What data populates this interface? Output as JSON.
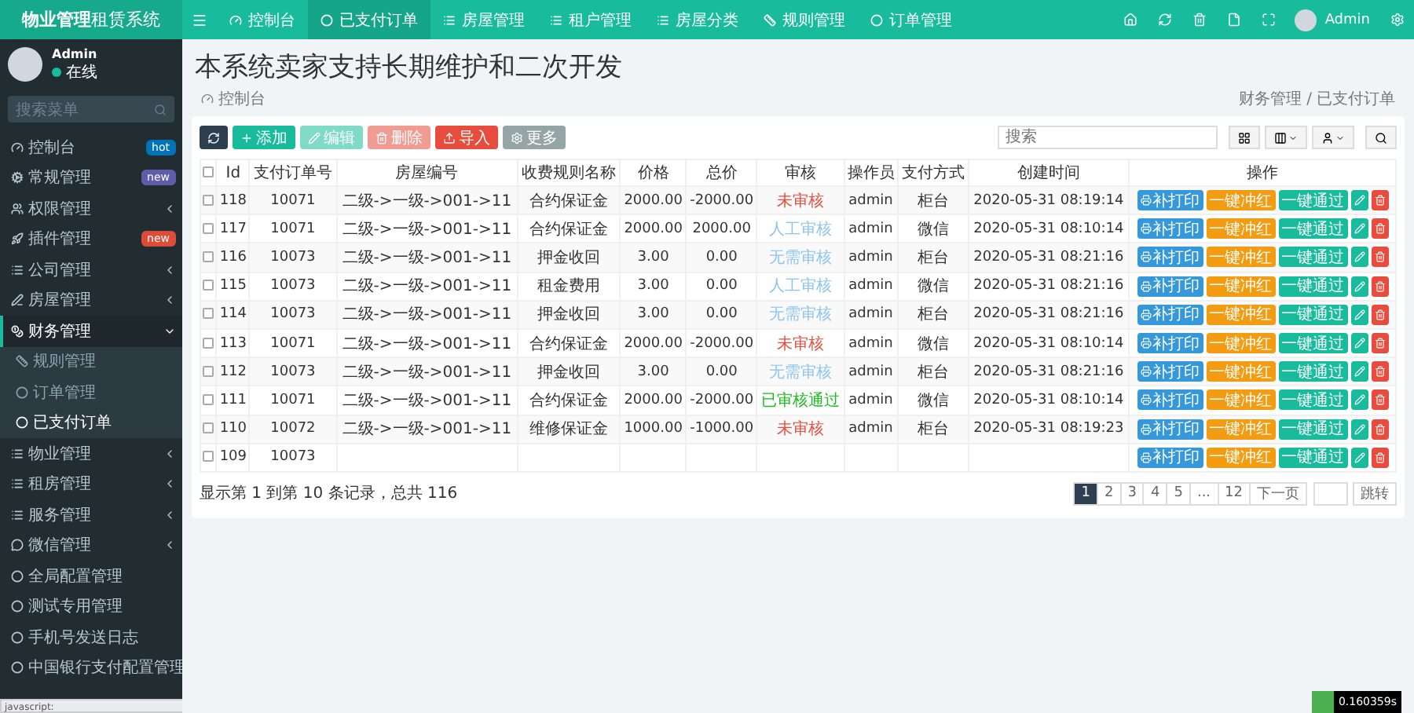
{
  "brand": {
    "bold": "物业管理",
    "rest": "租赁系统"
  },
  "user": {
    "name": "Admin",
    "status": "在线"
  },
  "sidebar": {
    "search_placeholder": "搜索菜单",
    "items": [
      {
        "label": "控制台",
        "badge": {
          "text": "hot",
          "color": "#0073b7"
        }
      },
      {
        "label": "常规管理",
        "badge": {
          "text": "new",
          "color": "#605ca8"
        }
      },
      {
        "label": "权限管理",
        "arrow": true
      },
      {
        "label": "插件管理",
        "badge": {
          "text": "new",
          "color": "#dd4b39"
        }
      },
      {
        "label": "公司管理",
        "arrow": true
      },
      {
        "label": "房屋管理",
        "arrow": true
      },
      {
        "label": "财务管理",
        "arrow": true,
        "expanded": true,
        "children": [
          {
            "label": "规则管理",
            "selected": false
          },
          {
            "label": "订单管理",
            "selected": false
          },
          {
            "label": "已支付订单",
            "selected": true
          }
        ]
      },
      {
        "label": "物业管理",
        "arrow": true
      },
      {
        "label": "租房管理",
        "arrow": true
      },
      {
        "label": "服务管理",
        "arrow": true
      },
      {
        "label": "微信管理",
        "arrow": true
      },
      {
        "label": "全局配置管理"
      },
      {
        "label": "测试专用管理"
      },
      {
        "label": "手机号发送日志"
      },
      {
        "label": "中国银行支付配置管理"
      }
    ]
  },
  "topnav": {
    "tabs": [
      {
        "label": "控制台",
        "selected": false
      },
      {
        "label": "已支付订单",
        "selected": true
      },
      {
        "label": "房屋管理",
        "selected": false
      },
      {
        "label": "租户管理",
        "selected": false
      },
      {
        "label": "房屋分类",
        "selected": false
      },
      {
        "label": "规则管理",
        "selected": false
      },
      {
        "label": "订单管理",
        "selected": false
      }
    ],
    "user": "Admin"
  },
  "page": {
    "title": "本系统卖家支持长期维护和二次开发",
    "home": "控制台",
    "breadcrumb": [
      "财务管理",
      "已支付订单"
    ],
    "separator": "/"
  },
  "toolbar": {
    "buttons": [
      {
        "label": "添加",
        "kind": "add",
        "disabled": false
      },
      {
        "label": "编辑",
        "kind": "edit",
        "disabled": true
      },
      {
        "label": "删除",
        "kind": "delete",
        "disabled": true
      },
      {
        "label": "导入",
        "kind": "import",
        "disabled": false
      },
      {
        "label": "更多",
        "kind": "more",
        "disabled": false
      }
    ],
    "search_placeholder": "搜索"
  },
  "table": {
    "header_checked": false,
    "columns": [
      "Id",
      "支付订单号",
      "房屋编号",
      "收费规则名称",
      "价格",
      "总价",
      "审核",
      "操作员",
      "支付方式",
      "创建时间",
      "操作"
    ],
    "rows": [
      {
        "checked": false,
        "id": "118",
        "order_no": "10071",
        "house_no": "二级->一级->001->11",
        "rule": "合约保证金",
        "price": "2000.00",
        "total": "-2000.00",
        "status": {
          "text": "未审核",
          "color": "#e74c3c"
        },
        "operator": "admin",
        "pay_method": "柜台",
        "created": "2020-05-31 08:19:14",
        "actions": [
          "补打印",
          "一键冲红",
          "一键通过"
        ]
      },
      {
        "checked": false,
        "id": "117",
        "order_no": "10071",
        "house_no": "二级->一级->001->11",
        "rule": "合约保证金",
        "price": "2000.00",
        "total": "2000.00",
        "status": {
          "text": "人工审核",
          "color": "#8cc3f0"
        },
        "operator": "admin",
        "pay_method": "微信",
        "created": "2020-05-31 08:10:14",
        "actions": [
          "补打印",
          "一键冲红",
          "一键通过"
        ]
      },
      {
        "checked": false,
        "id": "116",
        "order_no": "10073",
        "house_no": "二级->一级->001->11",
        "rule": "押金收回",
        "price": "3.00",
        "total": "0.00",
        "status": {
          "text": "无需审核",
          "color": "#8cc3f0"
        },
        "operator": "admin",
        "pay_method": "柜台",
        "created": "2020-05-31 08:21:16",
        "actions": [
          "补打印",
          "一键冲红",
          "一键通过"
        ]
      },
      {
        "checked": false,
        "id": "115",
        "order_no": "10073",
        "house_no": "二级->一级->001->11",
        "rule": "租金费用",
        "price": "3.00",
        "total": "0.00",
        "status": {
          "text": "人工审核",
          "color": "#8cc3f0"
        },
        "operator": "admin",
        "pay_method": "微信",
        "created": "2020-05-31 08:21:16",
        "actions": [
          "补打印",
          "一键冲红",
          "一键通过"
        ]
      },
      {
        "checked": false,
        "id": "114",
        "order_no": "10073",
        "house_no": "二级->一级->001->11",
        "rule": "押金收回",
        "price": "3.00",
        "total": "0.00",
        "status": {
          "text": "无需审核",
          "color": "#8cc3f0"
        },
        "operator": "admin",
        "pay_method": "柜台",
        "created": "2020-05-31 08:21:16",
        "actions": [
          "补打印",
          "一键冲红",
          "一键通过"
        ]
      },
      {
        "checked": false,
        "id": "113",
        "order_no": "10071",
        "house_no": "二级->一级->001->11",
        "rule": "合约保证金",
        "price": "2000.00",
        "total": "-2000.00",
        "status": {
          "text": "未审核",
          "color": "#e74c3c"
        },
        "operator": "admin",
        "pay_method": "微信",
        "created": "2020-05-31 08:10:14",
        "actions": [
          "补打印",
          "一键冲红",
          "一键通过"
        ]
      },
      {
        "checked": false,
        "id": "112",
        "order_no": "10073",
        "house_no": "二级->一级->001->11",
        "rule": "押金收回",
        "price": "3.00",
        "total": "0.00",
        "status": {
          "text": "无需审核",
          "color": "#8cc3f0"
        },
        "operator": "admin",
        "pay_method": "柜台",
        "created": "2020-05-31 08:21:16",
        "actions": [
          "补打印",
          "一键冲红",
          "一键通过"
        ]
      },
      {
        "checked": false,
        "id": "111",
        "order_no": "10071",
        "house_no": "二级->一级->001->11",
        "rule": "合约保证金",
        "price": "2000.00",
        "total": "-2000.00",
        "status": {
          "text": "已审核通过",
          "color": "#18bc1c"
        },
        "operator": "admin",
        "pay_method": "微信",
        "created": "2020-05-31 08:10:14",
        "actions": [
          "补打印",
          "一键冲红",
          "一键通过"
        ]
      },
      {
        "checked": false,
        "id": "110",
        "order_no": "10072",
        "house_no": "二级->一级->001->11",
        "rule": "维修保证金",
        "price": "1000.00",
        "total": "-1000.00",
        "status": {
          "text": "未审核",
          "color": "#e74c3c"
        },
        "operator": "admin",
        "pay_method": "柜台",
        "created": "2020-05-31 08:19:23",
        "actions": [
          "补打印",
          "一键冲红",
          "一键通过"
        ]
      },
      {
        "checked": false,
        "id": "109",
        "order_no": "10073",
        "actions": [
          "补打印",
          "一键冲红",
          "一键通过"
        ]
      }
    ]
  },
  "pagination": {
    "summary": "显示第 1 到第 10 条记录，总共 116",
    "pages": [
      {
        "label": "1",
        "selected": true
      },
      {
        "label": "2",
        "selected": false
      },
      {
        "label": "3",
        "selected": false
      },
      {
        "label": "4",
        "selected": false
      },
      {
        "label": "5",
        "selected": false
      },
      {
        "label": "...",
        "selected": false
      },
      {
        "label": "12",
        "selected": false
      },
      {
        "label": "下一页",
        "selected": false
      }
    ],
    "jump": "跳转"
  },
  "status_bar": "javascript:",
  "debug_time": "0.160359s"
}
